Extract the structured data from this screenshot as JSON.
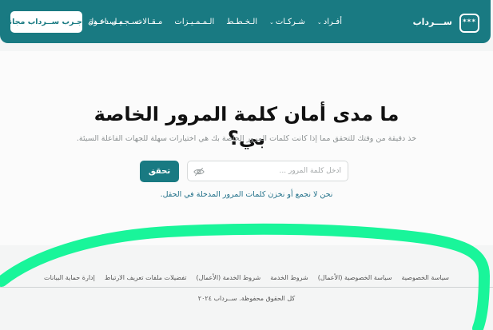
{
  "nav": {
    "logo_glyph": "***",
    "brand": "ســـرداب",
    "links": [
      "أفـراد",
      "شـركـات",
      "الـخـطـط",
      "الـمـمـيـزات",
      "مـقـالات",
      "مـسـاعـدة"
    ],
    "login": "تسـجـيـل دخـول",
    "try_button": "جـرب ســرداب مجاناً"
  },
  "hero": {
    "headline_line1": "ما مدى أمان كلمة المرور الخاصة",
    "headline_line2": "بي؟",
    "subtext": "خذ دقيقة من وقتك للتحقق مما إذا كانت كلمات المرور الخاصة بك هي اختيارات سهلة للجهات الفاعلة السيئة.",
    "input_placeholder": "أدخل كلمة المرور ...",
    "check_button": "تحقق",
    "privacy_note": "نحن لا نجمع أو نخزن كلمات المرور المدخلة في الحقل."
  },
  "footer": {
    "links": [
      "سياسة الخصوصية",
      "سياسة الخصوصية (الأعمال)",
      "شروط الخدمة",
      "شروط الخدمة (الأعمال)",
      "تفضيلات ملفات تعريف الارتباط",
      "إدارة حماية البيانات"
    ],
    "copyright": "كل الحقوق محفوظة. ســرداب ٢٠٢٤"
  },
  "colors": {
    "brand_teal": "#197a82",
    "annotation_green": "#19f59a"
  }
}
